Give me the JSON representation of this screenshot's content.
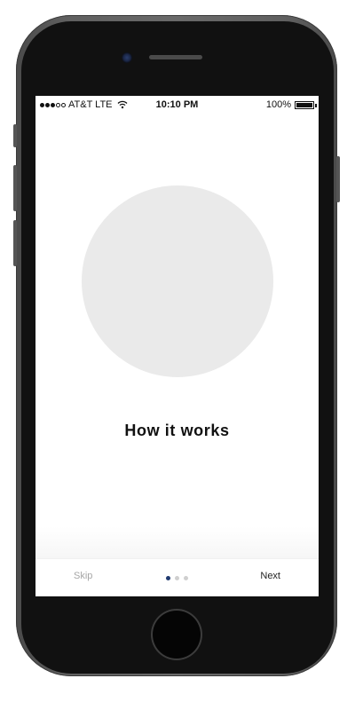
{
  "status_bar": {
    "carrier": "AT&T LTE",
    "time": "10:10 PM",
    "battery": "100%",
    "signal_bars_filled": 3,
    "signal_bars_total": 5,
    "battery_level": 1.0
  },
  "onboarding": {
    "title": "How it works",
    "page_index": 0,
    "page_count": 3
  },
  "footer": {
    "skip_label": "Skip",
    "next_label": "Next"
  },
  "colors": {
    "active_dot": "#203a70",
    "inactive_dot": "#cfcfcf",
    "placeholder_circle": "#eaeaea"
  }
}
